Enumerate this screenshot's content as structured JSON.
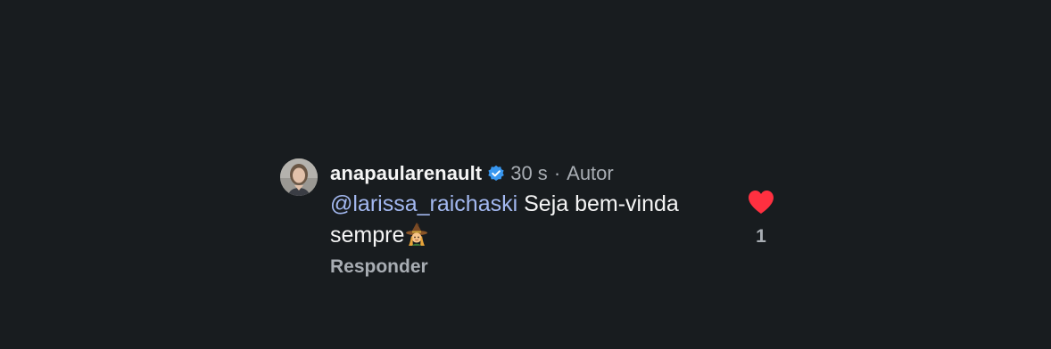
{
  "comment": {
    "username": "anapaularenault",
    "verified_icon": "verified-badge-icon",
    "time": "30 s",
    "separator": "·",
    "author_tag": "Autor",
    "mention": "@larissa_raichaski",
    "text_line1": " Seja bem-vinda",
    "text_line2": "sempre",
    "emoji": "witch-emoji",
    "reply_label": "Responder",
    "like_icon": "heart-filled-icon",
    "like_count": "1"
  },
  "colors": {
    "background": "#181c1f",
    "mention": "#a3b8f0",
    "verified": "#3897f0",
    "like": "#ff3040",
    "secondary_text": "#a8adb3"
  }
}
